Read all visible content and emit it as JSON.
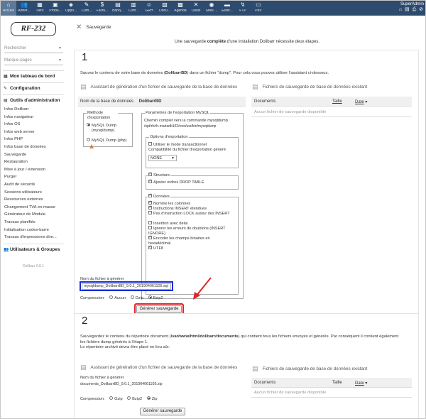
{
  "topbar": {
    "menu": [
      {
        "label": "Accueil",
        "icon": "home-icon",
        "glyph": "⌂"
      },
      {
        "label": "Adhér...",
        "icon": "members-icon",
        "glyph": "👥"
      },
      {
        "label": "Tiers",
        "icon": "thirdparty-icon",
        "glyph": "▦"
      },
      {
        "label": "Produ...",
        "icon": "product-icon",
        "glyph": "▣"
      },
      {
        "label": "Oppo...",
        "icon": "opportunity-icon",
        "glyph": "◈"
      },
      {
        "label": "Com...",
        "icon": "commercial-icon",
        "glyph": "✎"
      },
      {
        "label": "Factu...",
        "icon": "invoice-icon",
        "glyph": "$"
      },
      {
        "label": "Banq...",
        "icon": "bank-icon",
        "glyph": "▤"
      },
      {
        "label": "Com...",
        "icon": "accounting-icon",
        "glyph": "▥"
      },
      {
        "label": "GRH",
        "icon": "hr-icon",
        "glyph": "☺"
      },
      {
        "label": "Docu...",
        "icon": "documents-icon",
        "glyph": "▧"
      },
      {
        "label": "Agenda",
        "icon": "agenda-icon",
        "glyph": "▩"
      },
      {
        "label": "Outils",
        "icon": "tools-icon",
        "glyph": "✕"
      },
      {
        "label": "Sites ...",
        "icon": "websites-icon",
        "glyph": "◉"
      },
      {
        "label": "Exter...",
        "icon": "external-icon",
        "glyph": "▬"
      },
      {
        "label": "FTP",
        "icon": "ftp-icon",
        "glyph": "↯"
      },
      {
        "label": "PdV",
        "icon": "pos-icon",
        "glyph": "▭"
      }
    ],
    "user": "SuperAdmin",
    "user_icons": "⌂ ▤ ⎙ ⊘"
  },
  "sidebar": {
    "logo": "RF-232",
    "search1": "Rechercher",
    "search2": "Marque-pages",
    "dashboard": "Mon tableau de bord",
    "configuration": "Configuration",
    "admin_tools": "Outils d'administration",
    "items": [
      "Infos Dolibarr",
      "Infos navigateur",
      "Infos OS",
      "Infos web server",
      "Infos PHP",
      "Infos base de données",
      "Sauvegarde",
      "Restauration",
      "Mise à jour / extension",
      "Purger",
      "Audit de sécurité",
      "Sessions utilisateurs",
      "Ressources externes",
      "Changement TVA en masse",
      "Générateur de Module",
      "Travaux planifiés",
      "Initialisation codes-barre",
      "Travaux d'impressions dire..."
    ],
    "users_groups": "Utilisateurs & Groupes",
    "version": "Dolibarr 9.0.1"
  },
  "main": {
    "title": "Sauvegarde",
    "intro_pre": "Une sauvegarde ",
    "intro_bold": "complète",
    "intro_post": " d'une installation Dolibarr nécessite deux étapes.",
    "step1": {
      "number": "1",
      "desc_pre": "Sauvez le contenu de votre base de données (",
      "desc_bold": "DolibarrBD",
      "desc_post": ") dans un fichier \"dump\". Pour cela vous pouvez utiliser l'assistant ci-dessous.",
      "assistant_title": "Assistant de génération d'un fichier de sauvegarde de la base de données",
      "existing_title": "Fichiers de sauvegarde de base de données existant",
      "dbname_label": "Nom de la base de données",
      "dbname_value": "DolibarrBD",
      "method_legend": "Méthode d'exportation",
      "method_mysqldump": "MySQL Dump (mysqldump)",
      "method_php": "MySQL Dump (php)",
      "params_legend": "Paramètres de l'exportation MySQL",
      "fullpath_label": "Chemin complet vers la commande mysqldump",
      "fullpath_value": "/opt/rh/rh-mariadb102/root/usr/bin/mysqldump",
      "export_options_legend": "Options d'exportation",
      "transactional": "Utiliser le mode transactionnel",
      "compat_label": "Compatibilité du fichier d'exportation généré",
      "compat_value": "NONE",
      "structure": "Structure",
      "drop_table": "Ajouter ordres DROP TABLE",
      "donnees": "Données",
      "col_names": "Nomme les colonnes",
      "extended_insert": "Instructions INSERT étendues",
      "no_lock": "Pas d'instruction LOCK autour des INSERT",
      "delayed_insert": "Insertion avec délai",
      "ignore_errors": "Ignorer les erreurs de doublons (INSERT IGNORE)",
      "hex_binary": "Encoder les champs binaires en hexadécimal",
      "utf8": "UTF8",
      "filename_label": "Nom du fichier à générer",
      "filename_value": "mysqldump_DolibarrBD_9.0.1_201904061105.sql",
      "compression_label": "Compression:",
      "comp_none": "Aucun",
      "comp_gzip": "Gzip",
      "comp_bzip2": "Bzip2",
      "generate_button": "Générer sauvegarde",
      "col_documents": "Documents",
      "col_size": "Taille",
      "col_date": "Date",
      "no_backup": "Aucun fichier de sauvegarde disponible"
    },
    "step2": {
      "number": "2",
      "desc_pre": "Sauvegardez le contenu du répertoire document (",
      "desc_bold": "/var/www/html/dolibarr/documents",
      "desc_post": ") qui contient tous les fichiers envoyés et générés. Par conséquent il contient également",
      "desc_line2": "les fichiers dump générés à l'étape 1.",
      "desc_line3": "Le répertoire archivé devra être placé en lieu sûr.",
      "assistant_title": "Assistant de génération d'un fichier de sauvegarde de la base de données",
      "existing_title": "Fichiers de sauvegarde de base de données existant",
      "filename_label": "Nom du fichier à générer",
      "filename_value": "documents_DolibarrBD_9.0.1_201904061105.zip",
      "compression_label": "Compression:",
      "comp_gzip": "Gzip",
      "comp_bzip2": "Bzip2",
      "comp_zip": "Zip",
      "generate_button": "Générer sauvegarde",
      "col_documents": "Documents",
      "col_size": "Taille",
      "col_date": "Date",
      "no_backup": "Aucun fichier de sauvegarde disponible"
    }
  },
  "colors": {
    "topbar": "#2d4b6e",
    "highlight_blue": "#1a2fd3",
    "highlight_red": "#e12525"
  }
}
